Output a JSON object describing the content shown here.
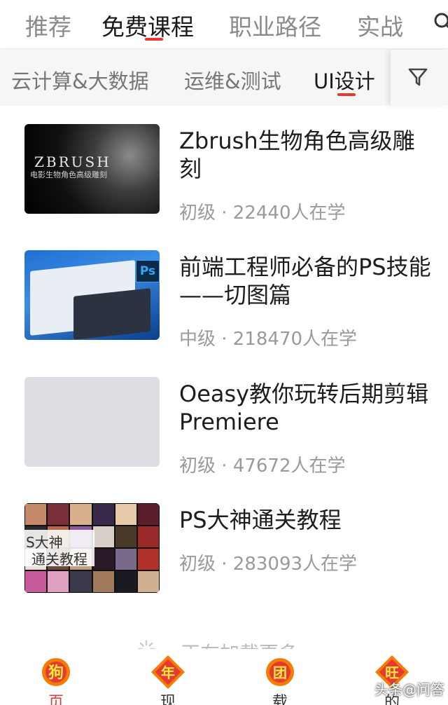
{
  "top_tabs": [
    {
      "label": "推荐",
      "active": false
    },
    {
      "label": "免费课程",
      "active": true
    },
    {
      "label": "职业路径",
      "active": false
    },
    {
      "label": "实战",
      "active": false
    }
  ],
  "sub_tabs": [
    {
      "label": "云计算&大数据",
      "active": false
    },
    {
      "label": "运维&测试",
      "active": false
    },
    {
      "label": "UI设计",
      "active": true
    }
  ],
  "courses": [
    {
      "title": "Zbrush生物角色高级雕刻",
      "meta": "初级 · 22440人在学",
      "thumb_text": "ZBRUSH",
      "thumb_sub": "电影生物角色高级雕刻"
    },
    {
      "title": "前端工程师必备的PS技能——切图篇",
      "meta": "中级 · 218470人在学",
      "thumb_badge": "Ps"
    },
    {
      "title": "Oeasy教你玩转后期剪辑Premiere",
      "meta": "初级 · 47672人在学"
    },
    {
      "title": "PS大神通关教程",
      "meta": "初级 · 283093人在学",
      "thumb_line1": "S大神",
      "thumb_line2": "通关教程"
    }
  ],
  "loading_text": "正在加载更多",
  "bottom_nav": [
    {
      "label": "页",
      "icon": "dog-icon",
      "glyph": "狗",
      "active": true
    },
    {
      "label": "现",
      "icon": "new-year-icon",
      "glyph": "年",
      "active": false
    },
    {
      "label": "载",
      "icon": "group-icon",
      "glyph": "团",
      "active": false
    },
    {
      "label": "的",
      "icon": "wang-icon",
      "glyph": "旺",
      "active": false
    }
  ],
  "watermark": "头条@问答",
  "colors": {
    "accent": "#e53935",
    "muted": "#8a8a8a",
    "festive": "#f57c00"
  }
}
